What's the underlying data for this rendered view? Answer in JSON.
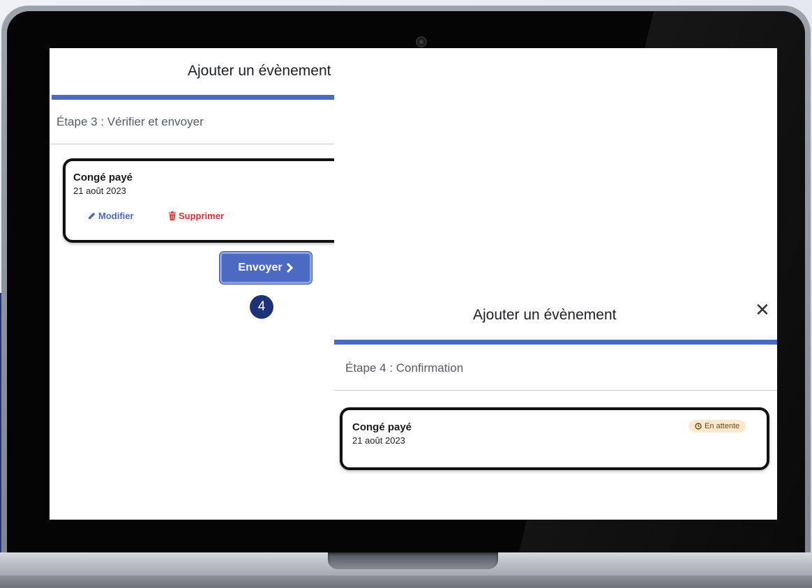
{
  "step3_modal": {
    "title": "Ajouter un évènement",
    "close_glyph": "✕",
    "progress_fraction": 0.75,
    "step_label": "Étape 3 : Vérifier et envoyer",
    "event": {
      "title": "Congé payé",
      "date": "21 août 2023",
      "edit_label": "Modifier",
      "delete_label": "Supprimer"
    },
    "submit_label": "Envoyer",
    "callout_number": "4"
  },
  "step4_modal": {
    "title": "Ajouter un évènement",
    "close_glyph": "✕",
    "progress_fraction": 1.0,
    "step_label": "Étape 4 : Confirmation",
    "event": {
      "title": "Congé payé",
      "date": "21 août 2023",
      "status": "En attente"
    }
  },
  "colors": {
    "accent": "#4a6ac3",
    "progress_track": "#d8e1f3",
    "delete": "#e33131",
    "badge": "#1e3377",
    "pending_bg": "#fbe8cf",
    "pending_text": "#6e4a12"
  },
  "icons": {
    "edit": "pencil-icon",
    "delete": "trash-icon",
    "submit": "chevron-right-icon",
    "status": "clock-icon",
    "close": "close-icon"
  }
}
